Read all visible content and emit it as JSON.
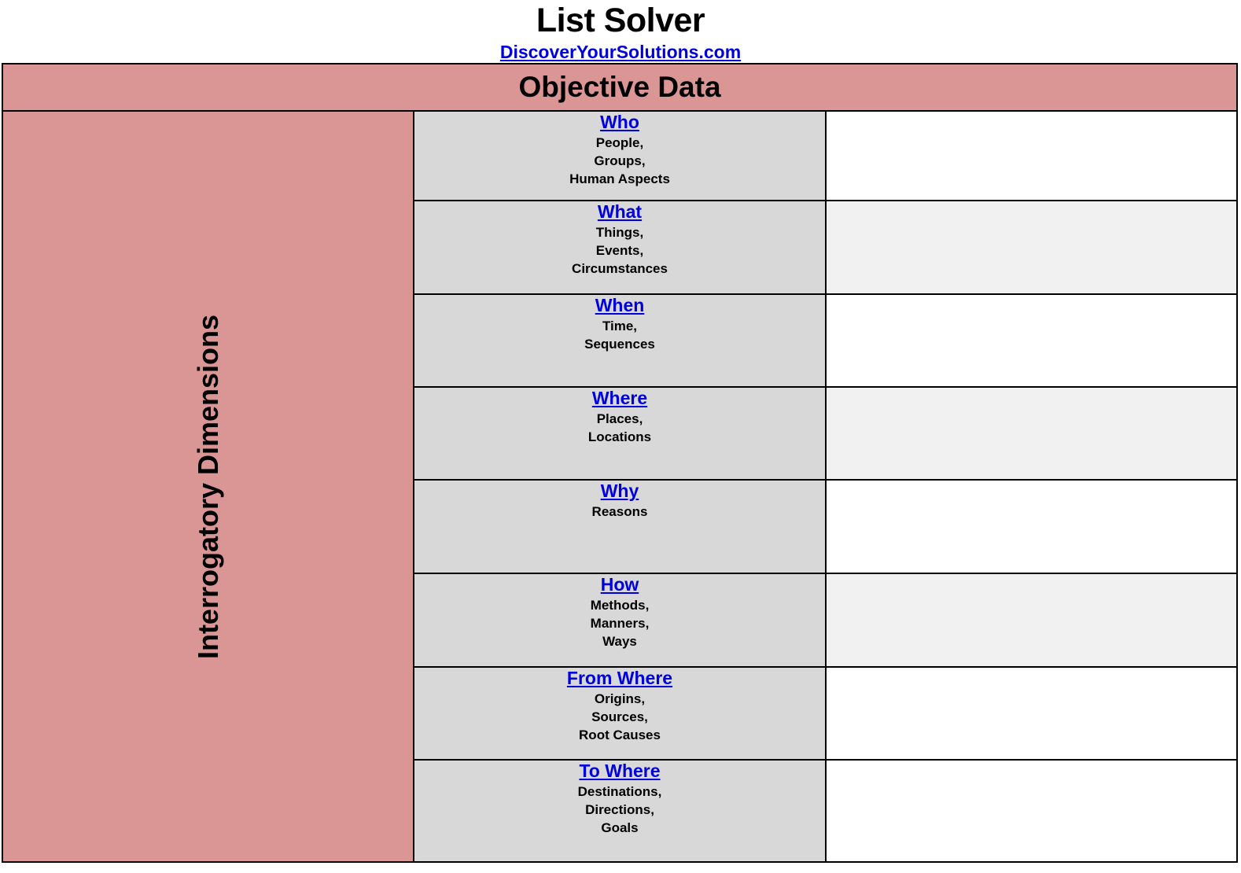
{
  "header": {
    "app_title": "List Solver",
    "site_link": "DiscoverYourSolutions.com"
  },
  "banner": {
    "label": "Objective Data"
  },
  "axis": {
    "label": "Interrogatory Dimensions"
  },
  "colors": {
    "banner_pink": "#da9595",
    "label_gray": "#d8d8d8",
    "row_alt_gray": "#f1f1f1",
    "link_blue": "#0000dd",
    "border_black": "#000000"
  },
  "rows": [
    {
      "dimension": "Who",
      "description": "People,\nGroups,\nHuman Aspects",
      "desc_lines": [
        "People,",
        "Groups,",
        "Human Aspects"
      ],
      "answer": "",
      "shade": "white"
    },
    {
      "dimension": "What",
      "description": "Things,\nEvents,\nCircumstances",
      "desc_lines": [
        "Things,",
        "Events,",
        "Circumstances"
      ],
      "answer": "",
      "shade": "gray"
    },
    {
      "dimension": "When",
      "description": "Time,\nSequences",
      "desc_lines": [
        "Time,",
        "Sequences"
      ],
      "answer": "",
      "shade": "white"
    },
    {
      "dimension": "Where",
      "description": "Places,\nLocations",
      "desc_lines": [
        "Places,",
        "Locations"
      ],
      "answer": "",
      "shade": "gray"
    },
    {
      "dimension": "Why",
      "description": "Reasons",
      "desc_lines": [
        "Reasons"
      ],
      "answer": "",
      "shade": "white"
    },
    {
      "dimension": "How",
      "description": "Methods,\nManners,\nWays",
      "desc_lines": [
        "Methods,",
        "Manners,",
        "Ways"
      ],
      "answer": "",
      "shade": "gray"
    },
    {
      "dimension": "From Where",
      "description": "Origins,\nSources,\nRoot Causes",
      "desc_lines": [
        "Origins,",
        "Sources,",
        "Root Causes"
      ],
      "answer": "",
      "shade": "white"
    },
    {
      "dimension": "To Where",
      "description": "Destinations,\nDirections,\nGoals",
      "desc_lines": [
        "Destinations,",
        "Directions,",
        "Goals"
      ],
      "answer": "",
      "shade": "white"
    }
  ]
}
